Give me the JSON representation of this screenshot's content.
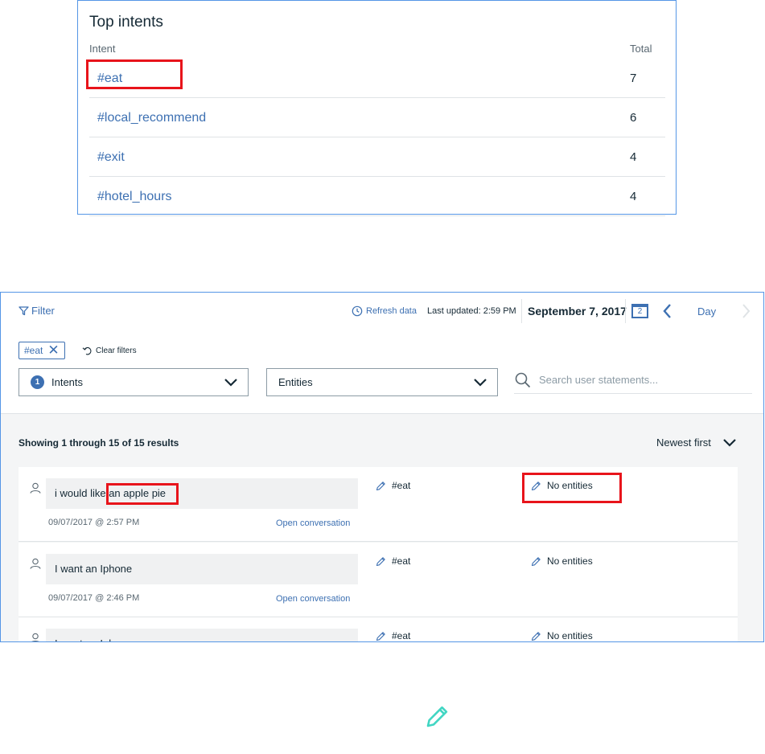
{
  "top_intents": {
    "title": "Top intents",
    "col_intent": "Intent",
    "col_total": "Total",
    "rows": [
      {
        "intent": "#eat",
        "total": "7"
      },
      {
        "intent": "#local_recommend",
        "total": "6"
      },
      {
        "intent": "#exit",
        "total": "4"
      },
      {
        "intent": "#hotel_hours",
        "total": "4"
      }
    ]
  },
  "toolbar": {
    "filter_label": "Filter",
    "refresh_label": "Refresh data",
    "last_updated": "Last updated: 2:59 PM",
    "date": "September 7, 2017",
    "calendar_day": "2",
    "period": "Day"
  },
  "filters": {
    "active_chip": "#eat",
    "clear_label": "Clear filters",
    "intents_label": "Intents",
    "intents_count": "1",
    "entities_label": "Entities",
    "search_placeholder": "Search user statements..."
  },
  "results": {
    "count_text": "Showing 1 through 15 of 15 results",
    "sort_label": "Newest first",
    "open_label": "Open conversation",
    "rows": [
      {
        "statement": "i would like an apple pie",
        "timestamp": "09/07/2017 @ 2:57 PM",
        "intent": "#eat",
        "entities": "No entities"
      },
      {
        "statement": "I want an Iphone",
        "timestamp": "09/07/2017 @ 2:46 PM",
        "intent": "#eat",
        "entities": "No entities"
      },
      {
        "statement": "I want an Iphone",
        "timestamp": "",
        "intent": "#eat",
        "entities": "No entities"
      }
    ]
  },
  "colors": {
    "accent": "#3d70b2",
    "highlight": "#e8141b",
    "pencil_teal": "#41d6c3"
  }
}
